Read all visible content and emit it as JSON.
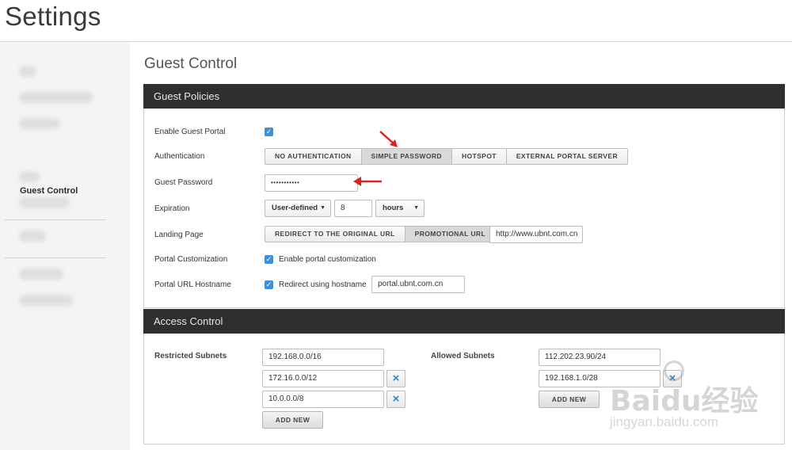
{
  "page": {
    "title": "Settings"
  },
  "sidebar": {
    "active_item": "Guest Control"
  },
  "guest_control": {
    "title": "Guest Control",
    "guest_policies": {
      "header": "Guest Policies",
      "enable_guest_portal": {
        "label": "Enable Guest Portal",
        "checked": true
      },
      "authentication": {
        "label": "Authentication",
        "options": [
          "NO AUTHENTICATION",
          "SIMPLE PASSWORD",
          "HOTSPOT",
          "EXTERNAL PORTAL SERVER"
        ],
        "selected": "SIMPLE PASSWORD"
      },
      "guest_password": {
        "label": "Guest Password",
        "value": "•••••••••••"
      },
      "expiration": {
        "label": "Expiration",
        "mode": "User-defined",
        "amount": "8",
        "unit": "hours"
      },
      "landing_page": {
        "label": "Landing Page",
        "options": [
          "REDIRECT TO THE ORIGINAL URL",
          "PROMOTIONAL URL"
        ],
        "selected": "PROMOTIONAL URL",
        "url": "http://www.ubnt.com.cn"
      },
      "portal_customization": {
        "label": "Portal Customization",
        "checkbox_text": "Enable portal customization",
        "checked": true
      },
      "portal_url_hostname": {
        "label": "Portal URL Hostname",
        "checkbox_text": "Redirect using hostname",
        "checked": true,
        "hostname": "portal.ubnt.com.cn"
      }
    },
    "access_control": {
      "header": "Access Control",
      "restricted_subnets": {
        "label": "Restricted Subnets",
        "items": [
          "192.168.0.0/16",
          "172.16.0.0/12",
          "10.0.0.0/8"
        ],
        "add_label": "ADD NEW"
      },
      "allowed_subnets": {
        "label": "Allowed Subnets",
        "items": [
          "112.202.23.90/24",
          "192.168.1.0/28"
        ],
        "add_label": "ADD NEW"
      }
    }
  },
  "watermark": {
    "logo": "Baidu经验",
    "url": "jingyan.baidu.com"
  },
  "icons": {
    "checkbox": "checkmark-icon",
    "remove": "close-x-icon",
    "select": "caret-down-icon",
    "annotation": "red-arrow-icon"
  },
  "colors": {
    "header_bg": "#2f2f2f",
    "accent_blue": "#3d8fd6",
    "annotation_red": "#e0201b"
  }
}
